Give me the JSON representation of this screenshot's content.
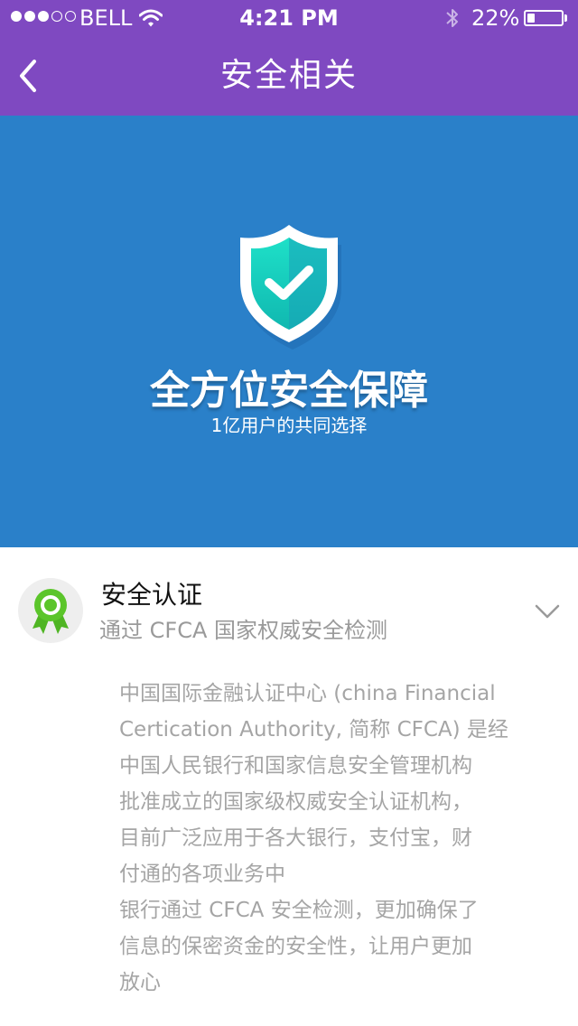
{
  "status_bar": {
    "carrier": "BELL",
    "time": "4:21 PM",
    "battery_percent": "22%",
    "battery_level": 0.22,
    "signal_strength": 3,
    "signal_max": 5
  },
  "nav": {
    "title": "安全相关",
    "back_icon": "chevron-left-icon"
  },
  "banner": {
    "title": "全方位安全保障",
    "subtitle": "1亿用户的共同选择",
    "icon": "shield-check-icon"
  },
  "security_item": {
    "title": "安全认证",
    "subtitle": "通过 CFCA 国家权威安全检测",
    "icon": "certificate-badge-icon",
    "expand_icon": "chevron-down-icon"
  },
  "description": {
    "lines": [
      "中国国际金融认证中心 (china Financial",
      "Certication Authority, 简称 CFCA) 是经",
      "中国人民银行和国家信息安全管理机构",
      "批准成立的国家级权威安全认证机构，",
      "目前广泛应用于各大银行，支付宝，财",
      "付通的各项业务中",
      "银行通过 CFCA 安全检测，更加确保了",
      "信息的保密资金的安全性，让用户更加",
      "放心"
    ]
  },
  "colors": {
    "nav_purple": "#7f49c1",
    "banner_blue": "#2a80c9",
    "badge_green": "#5bc52a",
    "muted_text": "#a5a5a5"
  }
}
